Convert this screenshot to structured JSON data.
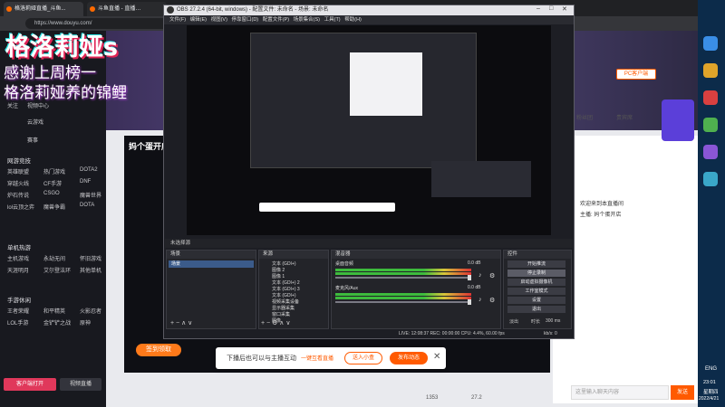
{
  "browser": {
    "tabs": [
      "格洛莉娅直播_斗鱼...",
      "斗鱼直播 - 直播…",
      "+"
    ],
    "address": "https://www.douyu.com/"
  },
  "overlay": {
    "logo": "格洛莉娅s",
    "thanks_line1": "感谢上周榜一",
    "thanks_line2": "格洛莉娅养的锦鲤"
  },
  "sidebar": {
    "items": [
      "关注",
      "视频中心",
      "云游戏",
      "赛事"
    ],
    "section1": "网游竞技",
    "row1": [
      "英雄联盟",
      "热门游戏",
      "DOTA2"
    ],
    "row2": [
      "穿越火线",
      "CF手游",
      "DNF"
    ],
    "row3": [
      "炉石传说",
      "CSGO",
      "魔兽世界"
    ],
    "row4": [
      "lol云顶之弈",
      "魔兽争霸",
      "DOTA"
    ],
    "section2": "单机热游",
    "row5": [
      "主机游戏",
      "永劫无间",
      "怀旧游戏"
    ],
    "row6": [
      "天涯明月",
      "艾尔登法环",
      "其他单机"
    ],
    "section3": "手游休闲",
    "row7": [
      "王者荣耀",
      "和平精英",
      "火影忍者"
    ],
    "row8": [
      "LOL手游",
      "金铲铲之战",
      "原神"
    ],
    "bottom_left": "客户端打开",
    "bottom_right": "视频直播"
  },
  "obs": {
    "title": "OBS 27.2.4 (64-bit, windows) - 配置文件: 未命名 - 场景: 未命名",
    "menu": [
      "文件(F)",
      "编辑(E)",
      "视图(V)",
      "停靠窗口(D)",
      "配置文件(P)",
      "场景集合(S)",
      "工具(T)",
      "帮助(H)"
    ],
    "scene_bar": "未选择源",
    "panels": {
      "scenes": "场景",
      "sources": "来源",
      "mixer": "混音器",
      "transitions": "转场特效",
      "controls": "控件"
    },
    "scene_item": "场景",
    "sources": [
      "文本 (GDI+)",
      "图像 2",
      "图像 1",
      "文本 (GDI+) 2",
      "文本 (GDI+) 3",
      "文本 (GDI+)",
      "视频采集设备",
      "显示器采集",
      "窗口采集",
      "图像"
    ],
    "mixer_tracks": [
      {
        "name": "桌面音频",
        "db": "0.0 dB"
      },
      {
        "name": "麦克风/Aux",
        "db": "0.0 dB"
      }
    ],
    "controls": [
      "开始推流",
      "停止录制",
      "启动虚拟摄像机",
      "工作室模式",
      "设置",
      "退出"
    ],
    "transition_label": "淡出",
    "duration_label": "时长",
    "duration": "300 ms",
    "status": "LIVE: 12:08:37  REC: 00:00:00  CPU: 4.4%, 60.00 fps",
    "status_bitrate": "kb/s: 0"
  },
  "popup": {
    "text": "下播后也可以与主播互动",
    "link": "一键互看直播",
    "gift_button": "送入小盒",
    "dm_button": "发布动态"
  },
  "page": {
    "stream_title": "妈个蛋开店",
    "sign_label": "签到领取",
    "chat_tabs": [
      "粉丝团",
      "贵宾席"
    ],
    "ad_label": "PC客户端",
    "chat_lines": [
      "欢迎来到本直播间",
      "主播: 妈个蛋开店"
    ],
    "chat_input_placeholder": "这里输入聊天内容",
    "send_button": "发送",
    "fans_count": "1353",
    "hot_count": "27.2"
  },
  "taskbar": {
    "time": "23:01",
    "day": "星期四",
    "date": "2022/4/21",
    "lang": "ENG"
  }
}
